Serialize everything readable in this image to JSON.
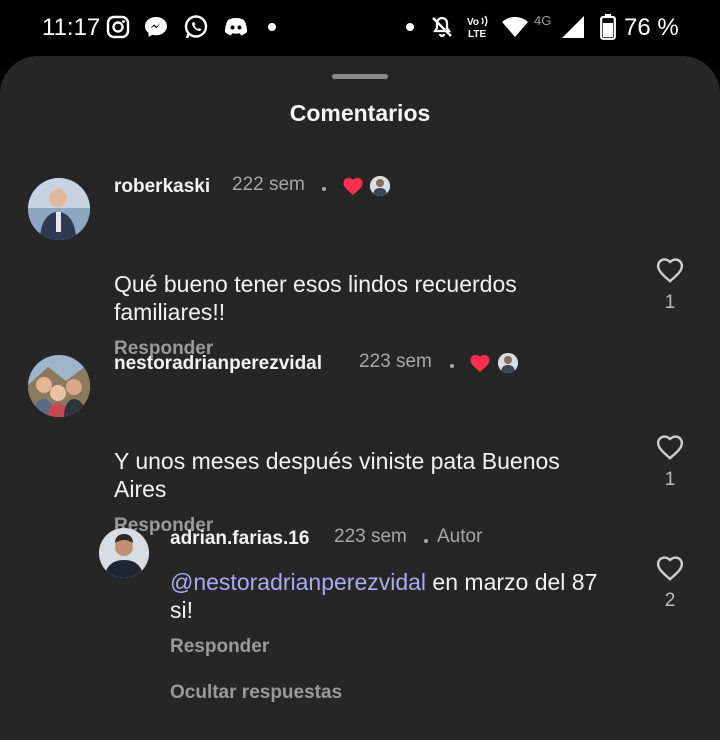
{
  "status_bar": {
    "time": "11:17",
    "battery_percent": "76 %",
    "network": "4G",
    "volte": "Vo LTE",
    "icons": [
      "instagram-icon",
      "messenger-icon",
      "whatsapp-icon",
      "discord-icon",
      "notification-dot-icon",
      "dot-icon",
      "mute-icon",
      "volte-icon",
      "wifi-icon",
      "signal-icon",
      "battery-icon"
    ]
  },
  "sheet": {
    "title": "Comentarios"
  },
  "comments": [
    {
      "author": "roberkaski",
      "time": "222 sem",
      "text": "Qué bueno tener esos lindos recuerdos familiares!!",
      "reply_label": "Responder",
      "likes": "1",
      "liked_by_author": true
    },
    {
      "author": "nestoradrianperezvidal",
      "time": "223 sem",
      "text": "Y unos meses después viniste pata Buenos Aires",
      "reply_label": "Responder",
      "likes": "1",
      "liked_by_author": true
    }
  ],
  "reply": {
    "author": "adrian.farias.16",
    "time": "223 sem",
    "badge": "Autor",
    "mention": "@nestoradrianperezvidal",
    "text": " en marzo del 87 si!",
    "reply_label": "Responder",
    "likes": "2"
  },
  "hide_replies_label": "Ocultar respuestas",
  "colors": {
    "sheet_bg": "#262626",
    "heart_red": "#ff2d4f",
    "mention": "#a6acf2",
    "muted": "#a8a8a8"
  }
}
